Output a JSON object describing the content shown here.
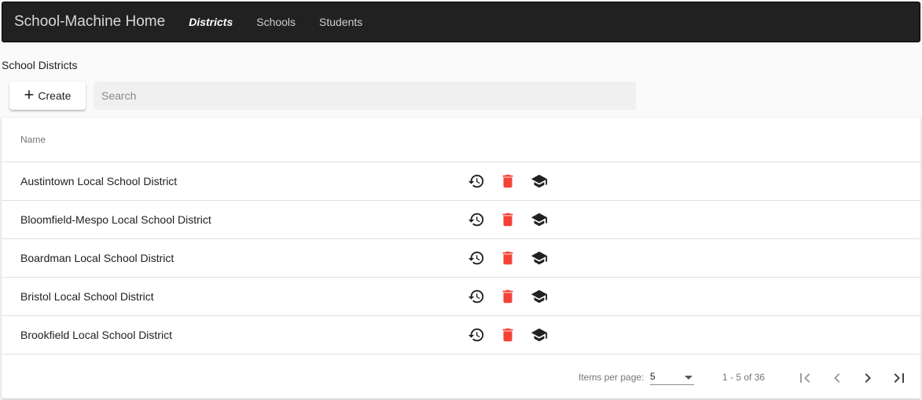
{
  "navbar": {
    "brand": "School-Machine Home",
    "links": [
      {
        "label": "Districts",
        "active": true
      },
      {
        "label": "Schools",
        "active": false
      },
      {
        "label": "Students",
        "active": false
      }
    ]
  },
  "page": {
    "title": "School Districts",
    "create_label": "Create",
    "search_placeholder": "Search"
  },
  "table": {
    "columns": [
      "Name"
    ],
    "rows": [
      {
        "name": "Austintown Local School District"
      },
      {
        "name": "Bloomfield-Mespo Local School District"
      },
      {
        "name": "Boardman Local School District"
      },
      {
        "name": "Bristol Local School District"
      },
      {
        "name": "Brookfield Local School District"
      }
    ],
    "row_actions": [
      "history-icon",
      "delete-icon",
      "school-icon"
    ]
  },
  "paginator": {
    "items_per_page_label": "Items per page:",
    "items_per_page_value": "5",
    "range_label": "1 - 5 of 36"
  },
  "colors": {
    "navbar_bg": "#212121",
    "delete": "#f44336",
    "icon": "#212121"
  }
}
